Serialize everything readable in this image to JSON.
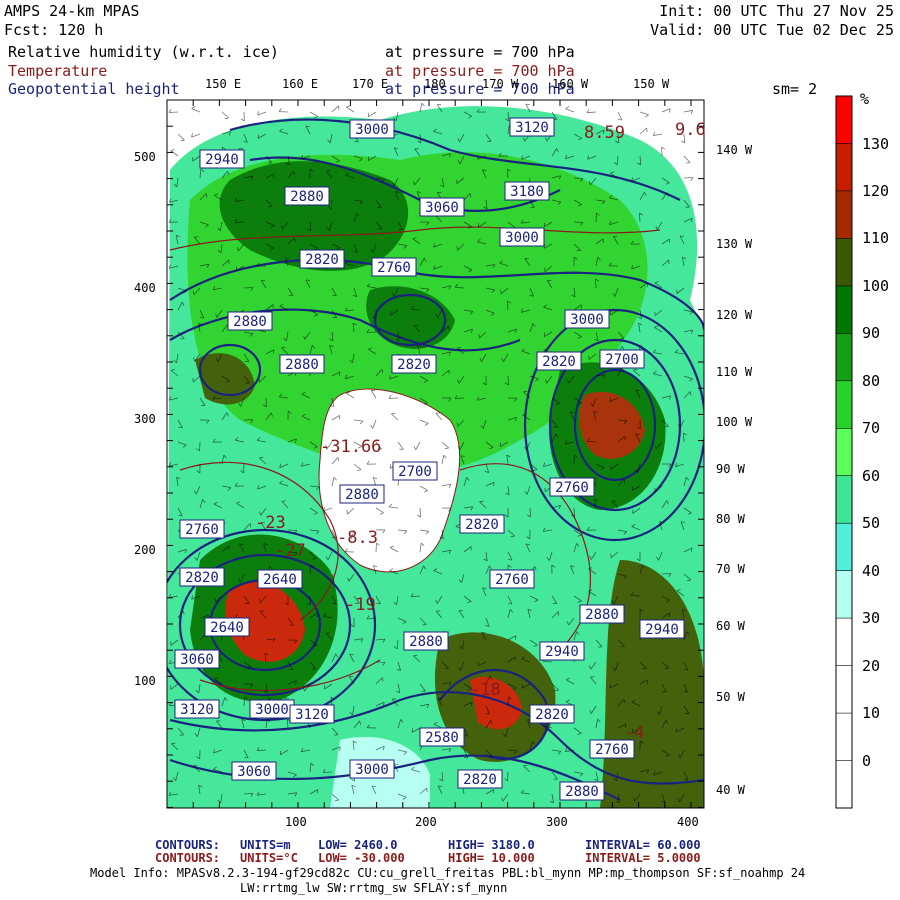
{
  "header": {
    "model": "AMPS 24-km MPAS",
    "init": "Init: 00 UTC Thu 27 Nov 25",
    "fcst": "Fcst:  120 h",
    "valid": "Valid: 00 UTC Tue 02 Dec 25"
  },
  "fields": [
    {
      "name": "Relative humidity (w.r.t. ice)",
      "level": "at pressure =  700 hPa",
      "color": "#000000"
    },
    {
      "name": "Temperature",
      "level": "at pressure =  700 hPa",
      "color": "#8b1a1a"
    },
    {
      "name": "Geopotential height",
      "level": "at pressure =  700 hPa",
      "color": "#1a237e"
    }
  ],
  "smoothing": "sm= 2",
  "top_lon_labels": [
    "150 E",
    "160 E",
    "170 E",
    "180",
    "170 W",
    "160 W",
    "150 W"
  ],
  "right_lon_labels": [
    "140 W",
    "130 W",
    "120 W",
    "110 W",
    "100 W",
    "90 W",
    "80 W",
    "70 W",
    "60 W",
    "50 W",
    "40 W"
  ],
  "y_ticks": [
    "500",
    "400",
    "300",
    "200",
    "100"
  ],
  "x_ticks": [
    "100",
    "200",
    "300",
    "400"
  ],
  "colorbar": {
    "unit": "%",
    "labels": [
      "130",
      "120",
      "110",
      "100",
      "90",
      "80",
      "70",
      "60",
      "50",
      "40",
      "30",
      "20",
      "10",
      "0"
    ],
    "colors": [
      "#ff0000",
      "#c81e00",
      "#a52a00",
      "#3a5a00",
      "#007800",
      "#14a014",
      "#28d228",
      "#5aff5a",
      "#3ce696",
      "#50f0dc",
      "#b4fff0",
      "#ffffff",
      "#ffffff",
      "#ffffff",
      "#ffffff"
    ]
  },
  "map_labels": {
    "height_boxes": [
      "3000",
      "3120",
      "2940",
      "2880",
      "3180",
      "3060",
      "3000",
      "2820",
      "2760",
      "2880",
      "3000",
      "2820",
      "2880",
      "2700",
      "2820",
      "2700",
      "2880",
      "2760",
      "2820",
      "2640",
      "2760",
      "2820",
      "2640",
      "2760",
      "2880",
      "2940",
      "2880",
      "3060",
      "2940",
      "3000",
      "3120",
      "3120",
      "3060",
      "3000",
      "2820",
      "2760",
      "2580",
      "2820",
      "2880"
    ],
    "temp_labels": [
      "8.59",
      "9.6",
      "-31.66",
      "-8.3",
      "-23",
      "-27",
      "-19",
      "-18",
      "-4"
    ]
  },
  "footer": {
    "line1": {
      "prefix": "CONTOURS:",
      "units": "UNITS=m",
      "low": "LOW=  2460.0",
      "high": "HIGH=  3180.0",
      "interval": "INTERVAL=  60.000"
    },
    "line2": {
      "prefix": "CONTOURS:",
      "units": "UNITS=°C",
      "low": "LOW= -30.000",
      "high": "HIGH=  10.000",
      "interval": "INTERVAL=  5.0000"
    },
    "model_info": "Model Info: MPASv8.2.3-194-gf29cd82c CU:cu_grell_freitas PBL:bl_mynn MP:mp_thompson SF:sf_noahmp 24",
    "model_info2": "LW:rrtmg_lw SW:rrtmg_sw SFLAY:sf_mynn"
  }
}
